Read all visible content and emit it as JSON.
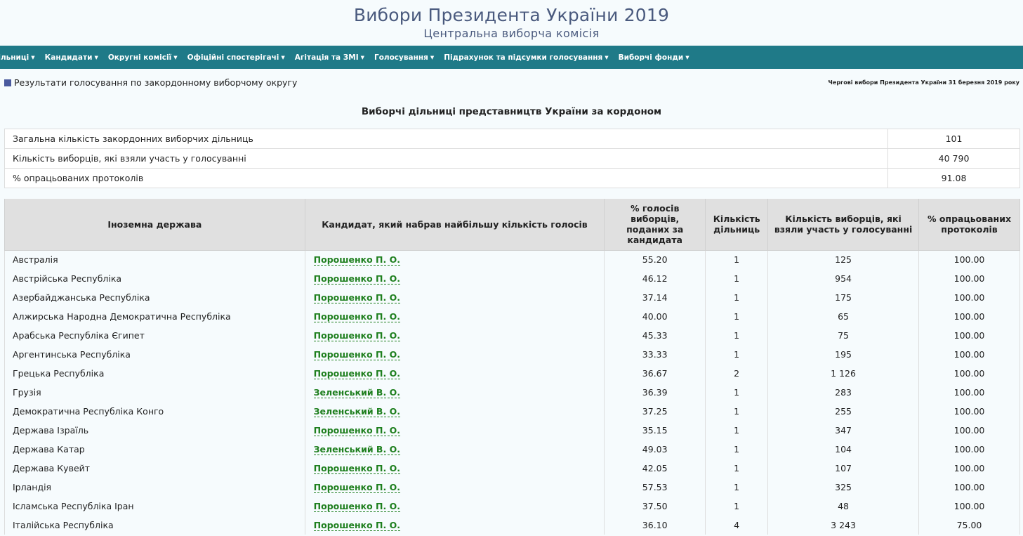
{
  "header": {
    "title": "Вибори Президента України 2019",
    "subtitle": "Центральна виборча комісія"
  },
  "nav": {
    "items": [
      "Дільниці",
      "Кандидати",
      "Округні комісії",
      "Офіційні спостерігачі",
      "Агітація та ЗМІ",
      "Голосування",
      "Підрахунок та підсумки голосування",
      "Виборчі фонди"
    ],
    "caret": "▼"
  },
  "subbar": {
    "breadcrumb": "Результати голосування по закордонному виборчому округу",
    "election": "Чергові вибори Президента України 31 березня 2019 року",
    "square_color": "#4a5a9e"
  },
  "section_title": "Виборчі дільниці представництв України за кордоном",
  "summary": [
    {
      "label": "Загальна кількість закордонних виборчих дільниць",
      "value": "101"
    },
    {
      "label": "Кількість виборців, які взяли участь у голосуванні",
      "value": "40 790"
    },
    {
      "label": "% опрацьованих протоколів",
      "value": "91.08"
    }
  ],
  "table": {
    "headers": [
      "Іноземна держава",
      "Кандидат, який набрав найбільшу кількість голосів",
      "% голосів виборців, поданих за кандидата",
      "Кількість дільниць",
      "Кількість виборців, які взяли участь у голосуванні",
      "% опрацьованих протоколів"
    ],
    "rows": [
      [
        "Австралія",
        "Порошенко П. О.",
        "55.20",
        "1",
        "125",
        "100.00"
      ],
      [
        "Австрійська Республіка",
        "Порошенко П. О.",
        "46.12",
        "1",
        "954",
        "100.00"
      ],
      [
        "Азербайджанська Республіка",
        "Порошенко П. О.",
        "37.14",
        "1",
        "175",
        "100.00"
      ],
      [
        "Алжирська Народна Демократична Республіка",
        "Порошенко П. О.",
        "40.00",
        "1",
        "65",
        "100.00"
      ],
      [
        "Арабська Республіка Єгипет",
        "Порошенко П. О.",
        "45.33",
        "1",
        "75",
        "100.00"
      ],
      [
        "Аргентинська Республіка",
        "Порошенко П. О.",
        "33.33",
        "1",
        "195",
        "100.00"
      ],
      [
        "Грецька Республіка",
        "Порошенко П. О.",
        "36.67",
        "2",
        "1 126",
        "100.00"
      ],
      [
        "Грузія",
        "Зеленський В. О.",
        "36.39",
        "1",
        "283",
        "100.00"
      ],
      [
        "Демократична Республіка Конго",
        "Зеленський В. О.",
        "37.25",
        "1",
        "255",
        "100.00"
      ],
      [
        "Держава Ізраїль",
        "Порошенко П. О.",
        "35.15",
        "1",
        "347",
        "100.00"
      ],
      [
        "Держава Катар",
        "Зеленський В. О.",
        "49.03",
        "1",
        "104",
        "100.00"
      ],
      [
        "Держава Кувейт",
        "Порошенко П. О.",
        "42.05",
        "1",
        "107",
        "100.00"
      ],
      [
        "Ірландія",
        "Порошенко П. О.",
        "57.53",
        "1",
        "325",
        "100.00"
      ],
      [
        "Ісламська Республіка Іран",
        "Порошенко П. О.",
        "37.50",
        "1",
        "48",
        "100.00"
      ],
      [
        "Італійська Республіка",
        "Порошенко П. О.",
        "36.10",
        "4",
        "3 243",
        "75.00"
      ]
    ]
  },
  "colors": {
    "navbar": "#1f7a88",
    "title": "#4a5a7e",
    "candidate_link": "#1e7f1e",
    "header_bg": "#e0e0e0"
  }
}
